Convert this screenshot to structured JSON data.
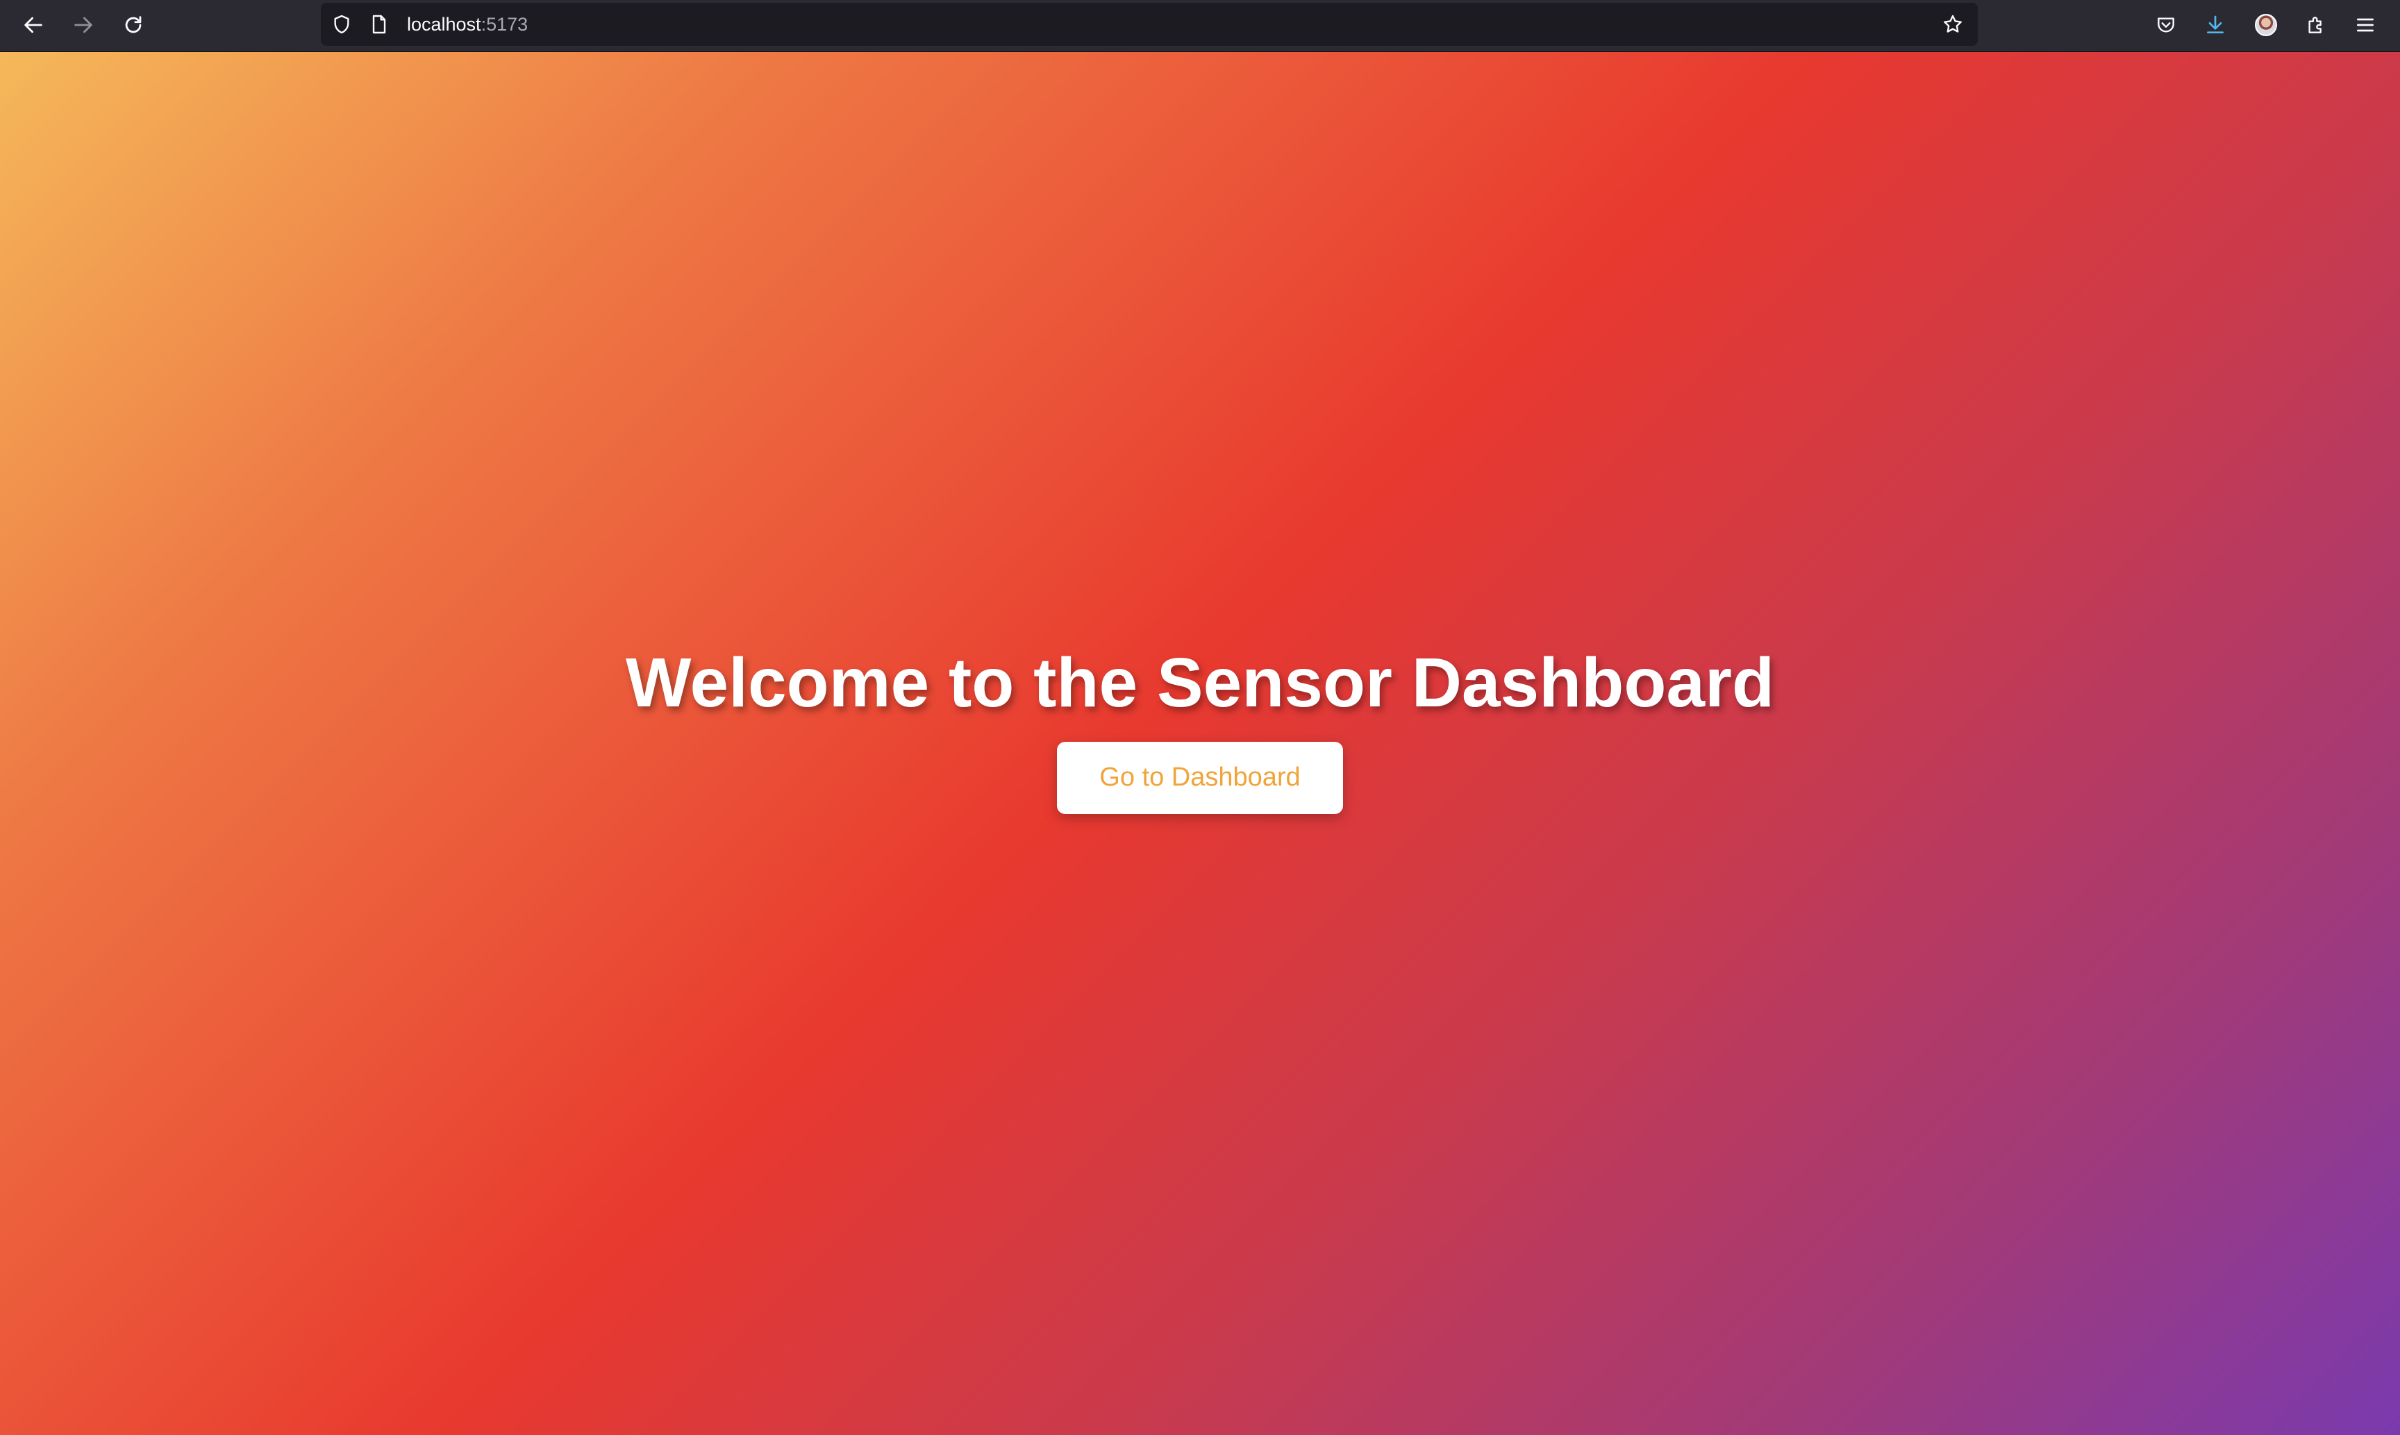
{
  "browser": {
    "url_host": "localhost",
    "url_port": ":5173",
    "icons": {
      "back": "back-arrow-icon",
      "forward": "forward-arrow-icon",
      "reload": "reload-icon",
      "tracking": "shield-icon",
      "page": "page-icon",
      "bookmark": "star-icon",
      "pocket": "pocket-icon",
      "downloads": "download-icon",
      "account": "avatar-icon",
      "extensions": "puzzle-icon",
      "menu": "hamburger-menu-icon"
    },
    "colors": {
      "chrome_bg": "#2b2a33",
      "urlbar_bg": "#1c1b22",
      "download_accent": "#54b8ec"
    }
  },
  "page": {
    "title": "Welcome to the Sensor Dashboard",
    "cta_label": "Go to Dashboard",
    "colors": {
      "gradient_start": "#f5b85a",
      "gradient_mid": "#e8392f",
      "gradient_end": "#7a3aae",
      "cta_text": "#f0a43a"
    }
  }
}
